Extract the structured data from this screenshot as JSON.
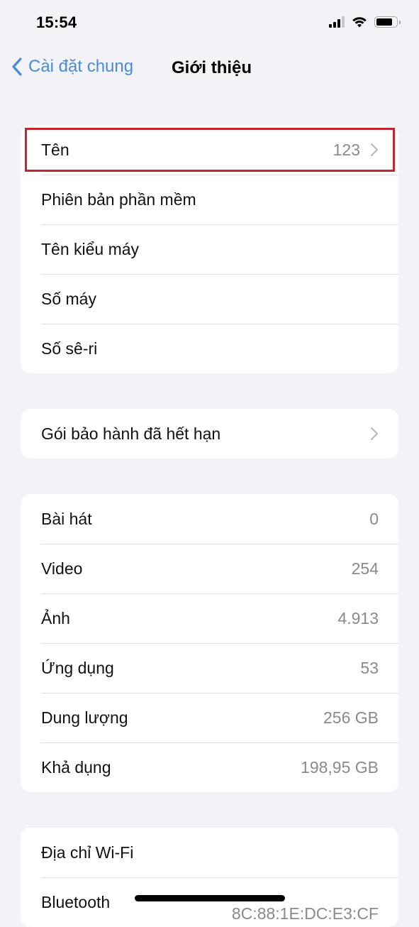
{
  "status_bar": {
    "time": "15:54",
    "icons": [
      "cellular-signal-icon",
      "wifi-icon",
      "battery-icon"
    ]
  },
  "nav": {
    "back_label": "Cài đặt chung",
    "title": "Giới thiệu",
    "accent_color": "#4a8bd6"
  },
  "groups": [
    {
      "rows": [
        {
          "label": "Tên",
          "value": "123",
          "chevron": true,
          "highlighted": true
        },
        {
          "label": "Phiên bản phần mềm",
          "value": ""
        },
        {
          "label": "Tên kiểu máy",
          "value": ""
        },
        {
          "label": "Số máy",
          "value": ""
        },
        {
          "label": "Số sê-ri",
          "value": ""
        }
      ]
    },
    {
      "rows": [
        {
          "label": "Gói bảo hành đã hết hạn",
          "value": "",
          "chevron": true
        }
      ]
    },
    {
      "rows": [
        {
          "label": "Bài hát",
          "value": "0"
        },
        {
          "label": "Video",
          "value": "254"
        },
        {
          "label": "Ảnh",
          "value": "4.913"
        },
        {
          "label": "Ứng dụng",
          "value": "53"
        },
        {
          "label": "Dung lượng",
          "value": "256 GB"
        },
        {
          "label": "Khả dụng",
          "value": "198,95 GB"
        }
      ]
    },
    {
      "rows": [
        {
          "label": "Địa chỉ Wi-Fi",
          "value": ""
        },
        {
          "label": "Bluetooth",
          "value": "8C:88:1E:DC:E3:CF"
        }
      ]
    }
  ],
  "highlight_color": "#c4242e"
}
